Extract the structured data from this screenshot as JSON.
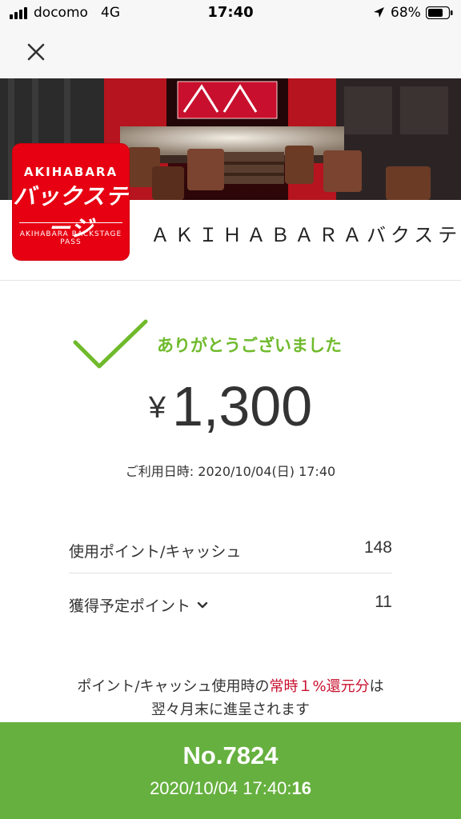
{
  "status_bar": {
    "carrier": "docomo",
    "network": "4G",
    "time": "17:40",
    "battery": "68%",
    "icons": [
      "signal-icon",
      "location-icon",
      "battery-icon"
    ]
  },
  "nav": {
    "close_icon": "close-icon"
  },
  "shop": {
    "name": "ＡＫＩＨＡＢＡＲＡバクステ",
    "logo": {
      "top_text": "AKIHABARA",
      "main_text": "バックステージ",
      "bottom_text": "AKIHABARA BACKSTAGE PASS",
      "background": "#e60012"
    }
  },
  "payment": {
    "thanks_message": "ありがとうございました",
    "currency": "¥",
    "amount": "1,300",
    "usage_date": "ご利用日時: 2020/10/04(日) 17:40",
    "accent_color": "#6fba2c"
  },
  "details": {
    "used_label": "使用ポイント/キャッシュ",
    "used_value": "148",
    "earned_label": "獲得予定ポイント",
    "earned_value": "11"
  },
  "note": {
    "part1": "ポイント/キャッシュ使用時の",
    "highlight": "常時１%還元分",
    "part2": "は",
    "line2": "翌々月末に進呈されます",
    "highlight_color": "#c8102e"
  },
  "footer": {
    "receipt_no": "No.7824",
    "datetime": "2020/10/04 17:40:",
    "seconds": "16",
    "background": "#66b03f"
  }
}
